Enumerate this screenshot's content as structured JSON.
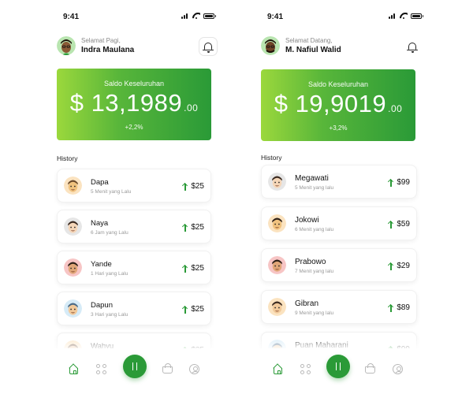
{
  "colors": {
    "accent": "#2a9a37",
    "accent_light": "#9bd83c",
    "muted": "#999999"
  },
  "screens": [
    {
      "time": "9:41",
      "greeting": "Selamat Pagi,",
      "user_name": "Indra Maulana",
      "card": {
        "title": "Saldo Keseluruhan",
        "currency": "$",
        "amount": "13,1989",
        "cents": ".00",
        "change": "+2,2%"
      },
      "history_label": "History",
      "history": [
        {
          "name": "Dapa",
          "time": "5 Menit yang Lalu",
          "amount": "$25",
          "avatar_bg": "#fbe3c0",
          "skin": "#f0c27e",
          "hair": "#6b4a2b"
        },
        {
          "name": "Naya",
          "time": "6 Jam yang Lalu",
          "amount": "$25",
          "avatar_bg": "#e6e6e6",
          "skin": "#f5d6b8",
          "hair": "#3b2a20"
        },
        {
          "name": "Yande",
          "time": "1 Hari yang Lalu",
          "amount": "$25",
          "avatar_bg": "#f7c5c5",
          "skin": "#e0a678",
          "hair": "#2e2018"
        },
        {
          "name": "Dapun",
          "time": "3 Hari yang Lalu",
          "amount": "$25",
          "avatar_bg": "#d6ebf7",
          "skin": "#f1c99a",
          "hair": "#4b6b87"
        },
        {
          "name": "Wahyu",
          "time": "",
          "amount": "$25",
          "avatar_bg": "#fbe3c0",
          "skin": "#e8b07a",
          "hair": "#5a3a20"
        }
      ],
      "nav": [
        "home-icon",
        "grid-icon",
        "swap-icon",
        "basket-icon",
        "profile-icon"
      ]
    },
    {
      "time": "9:41",
      "greeting": "Selamat Datang,",
      "user_name": "M. Nafiul Walid",
      "card": {
        "title": "Saldo Keseluruhan",
        "currency": "$",
        "amount": "19,9019",
        "cents": ".00",
        "change": "+3,2%"
      },
      "history_label": "History",
      "history": [
        {
          "name": "Megawati",
          "time": "5 Menit yang lalu",
          "amount": "$99",
          "avatar_bg": "#e6e6e6",
          "skin": "#f5d6b8",
          "hair": "#3b2a20"
        },
        {
          "name": "Jokowi",
          "time": "6 Menit yang lalu",
          "amount": "$59",
          "avatar_bg": "#fbe3c0",
          "skin": "#f0c27e",
          "hair": "#2e2018"
        },
        {
          "name": "Prabowo",
          "time": "7 Menit yang lalu",
          "amount": "$29",
          "avatar_bg": "#f7c5c5",
          "skin": "#e0a678",
          "hair": "#2e2018"
        },
        {
          "name": "Gibran",
          "time": "9 Menit yang lalu",
          "amount": "$89",
          "avatar_bg": "#fbe3c0",
          "skin": "#f1c99a",
          "hair": "#3b2a20"
        },
        {
          "name": "Puan Maharani",
          "time": "",
          "amount": "$99",
          "avatar_bg": "#d6ebf7",
          "skin": "#f1c99a",
          "hair": "#4b6b87"
        }
      ],
      "nav": [
        "home-icon",
        "grid-icon",
        "swap-icon",
        "basket-icon",
        "profile-icon"
      ]
    }
  ]
}
